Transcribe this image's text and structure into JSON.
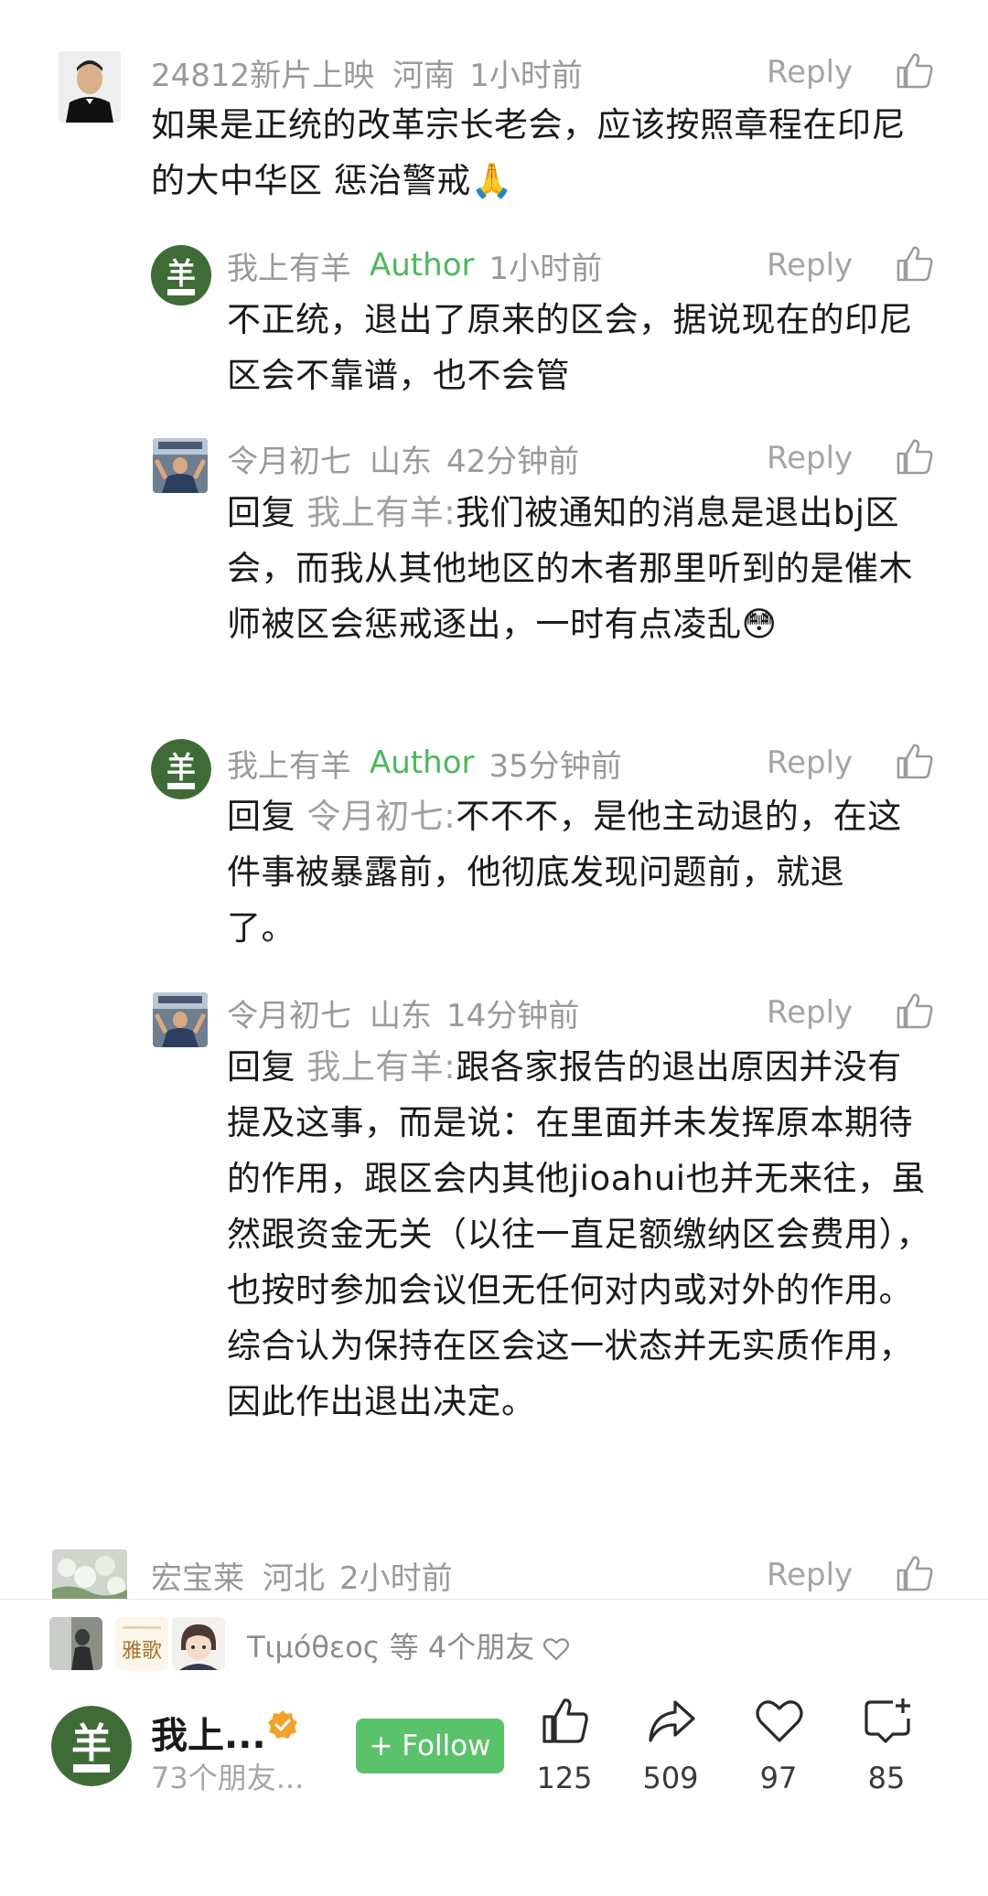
{
  "comments": [
    {
      "name": "24812新片上映",
      "region": "河南",
      "time": "1小时前",
      "text": "如果是正统的改革宗长老会，应该按照章程在印尼的大中华区 惩治警戒🙏",
      "reply_label": "Reply"
    },
    {
      "name": "我上有羊",
      "author_tag": "Author",
      "time": "1小时前",
      "text": "不正统，退出了原来的区会，据说现在的印尼区会不靠谱，也不会管",
      "reply_label": "Reply"
    },
    {
      "name": "令月初七",
      "region": "山东",
      "time": "42分钟前",
      "reply_prefix": "回复",
      "reply_to": "我上有羊:",
      "text": "我们被通知的消息是退出bj区会，而我从其他地区的木者那里听到的是催木师被区会惩戒逐出，一时有点凌乱😳",
      "reply_label": "Reply"
    },
    {
      "name": "我上有羊",
      "author_tag": "Author",
      "time": "35分钟前",
      "reply_prefix": "回复",
      "reply_to": "令月初七:",
      "text": "不不不，是他主动退的，在这件事被暴露前，他彻底发现问题前，就退了。",
      "reply_label": "Reply"
    },
    {
      "name": "令月初七",
      "region": "山东",
      "time": "14分钟前",
      "reply_prefix": "回复",
      "reply_to": "我上有羊:",
      "text": "跟各家报告的退出原因并没有提及这事，而是说：在里面并未发挥原本期待的作用，跟区会内其他jioahui也并无来往，虽然跟资金无关（以往一直足额缴纳区会费用），也按时参加会议但无任何对内或对外的作用。综合认为保持在区会这一状态并无实质作用，因此作出退出决定。",
      "reply_label": "Reply"
    },
    {
      "name": "宏宝莱",
      "region": "河北",
      "time": "2小时前",
      "reply_label": "Reply"
    }
  ],
  "friends": {
    "text": "Τιμόθεος 等 4个朋友",
    "avatar2_text": "雅歌"
  },
  "author_bar": {
    "avatar_char": "羊",
    "name": "我上...",
    "sub": "73个朋友...",
    "follow_label": "+ Follow",
    "like_count": "125",
    "share_count": "509",
    "heart_count": "97",
    "comment_count": "85"
  },
  "colors": {
    "author_green": "#4cb85c",
    "follow_green": "#5ac26a",
    "avatar_green": "#3f6b37",
    "verified_orange": "#f2a22a"
  },
  "icons": [
    "thumb-up-icon",
    "share-icon",
    "heart-icon",
    "comment-plus-icon",
    "verified-icon"
  ]
}
